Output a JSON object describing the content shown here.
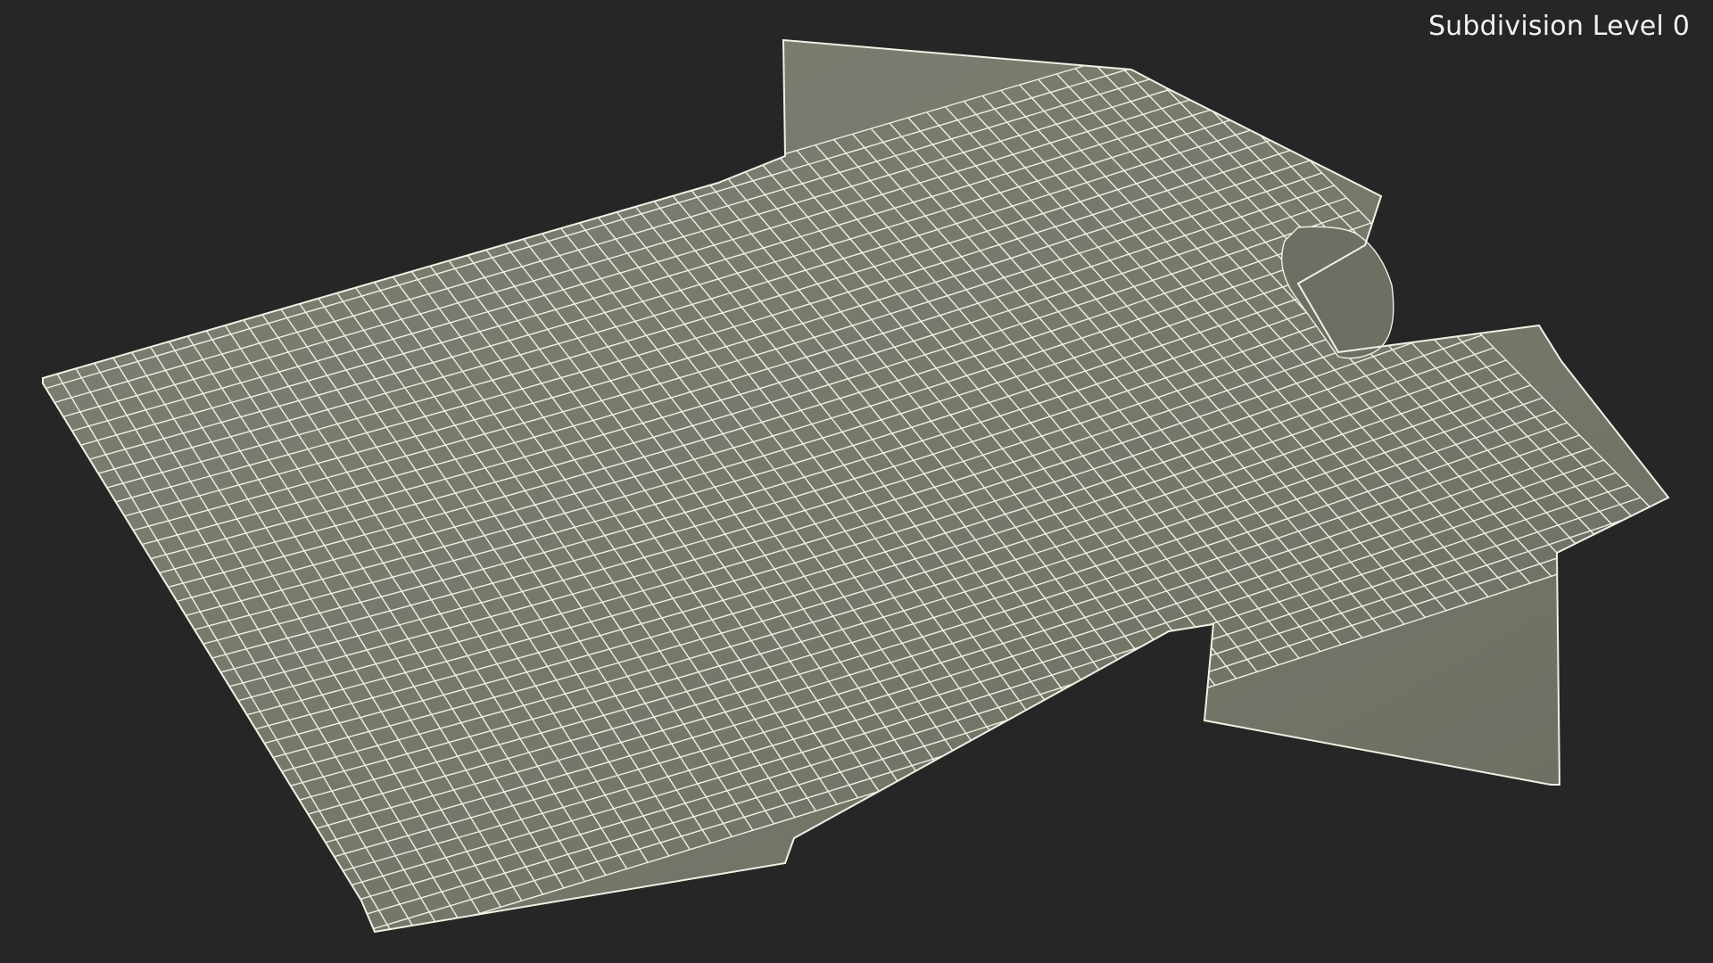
{
  "overlay": {
    "subdivision_label": "Subdivision Level 0"
  },
  "colors": {
    "background": "#262626",
    "mesh_fill": "#7a7a6e",
    "wire": "#f1f0e4",
    "label": "#f2f2f2"
  },
  "model": {
    "description_icon": "tshirt-wireframe-mesh"
  }
}
